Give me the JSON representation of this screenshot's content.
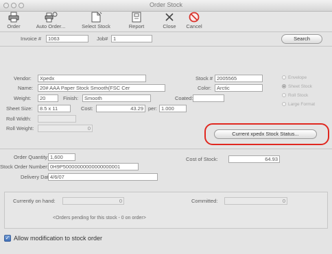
{
  "window": {
    "title": "Order Stock"
  },
  "toolbar": [
    {
      "name": "order",
      "label": "Order",
      "icon": "printer-icon"
    },
    {
      "name": "auto-order",
      "label": "Auto Order...",
      "icon": "auto-order-icon"
    },
    {
      "name": "select-stock",
      "label": "Select Stock",
      "icon": "select-stock-icon"
    },
    {
      "name": "report",
      "label": "Report",
      "icon": "report-icon"
    },
    {
      "name": "close",
      "label": "Close",
      "icon": "close-icon"
    },
    {
      "name": "cancel",
      "label": "Cancel",
      "icon": "cancel-icon"
    }
  ],
  "header": {
    "invoice_label": "Invoice #",
    "invoice_value": "1063",
    "job_label": "Job#",
    "job_value": "1",
    "search_label": "Search"
  },
  "stock": {
    "vendor_label": "Vendor:",
    "vendor_value": "Xpedx",
    "name_label": "Name:",
    "name_value": "20# AAA Paper Stock Smooth(FSC Cer",
    "weight_label": "Weight:",
    "weight_value": "20",
    "finish_label": "Finish:",
    "finish_value": "Smooth",
    "sheet_size_label": "Sheet Size:",
    "sheet_size_value": "8.5 x 11",
    "cost_label": "Cost:",
    "cost_value": "43.29",
    "per_label": "per:",
    "per_value": "1.000",
    "roll_width_label": "Roll Width:",
    "roll_width_value": "",
    "roll_weight_label": "Roll Weight:",
    "roll_weight_value": "0",
    "stock_no_label": "Stock #",
    "stock_no_value": "2005565",
    "color_label": "Color:",
    "color_value": "Arctic",
    "coated_label": "Coated:",
    "coated_value": "",
    "status_button_label": "Current xpedx Stock Status..."
  },
  "stock_type": {
    "options": [
      "Envelope",
      "Sheet Stock",
      "Roll Stock",
      "Large Format"
    ],
    "selected": "Sheet Stock"
  },
  "order": {
    "quantity_label": "Order Quantity:",
    "quantity_value": "1,600",
    "order_number_label": "Stock Order Number:",
    "order_number_value": "0H9P50000000000000000001",
    "delivery_label": "Delivery Date:",
    "delivery_value": "4/6/07",
    "cost_of_stock_label": "Cost of Stock:",
    "cost_of_stock_value": "64.93"
  },
  "inventory": {
    "on_hand_label": "Currently on hand:",
    "on_hand_value": "0",
    "committed_label": "Committed:",
    "committed_value": "0",
    "pending_text": "<Orders pending for this stock - 0 on order>"
  },
  "modification": {
    "checkbox_label": "Allow modification to stock order",
    "checked": true
  },
  "colors": {
    "highlight": "#e0271f",
    "checkbox": "#3e6fb8"
  }
}
